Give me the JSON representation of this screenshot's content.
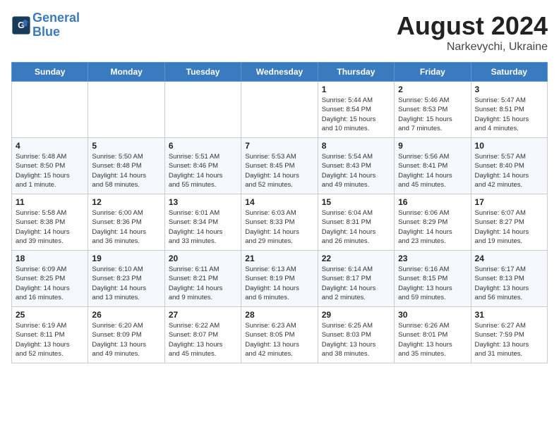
{
  "header": {
    "logo_line1": "General",
    "logo_line2": "Blue",
    "main_title": "August 2024",
    "sub_title": "Narkevychi, Ukraine"
  },
  "days_of_week": [
    "Sunday",
    "Monday",
    "Tuesday",
    "Wednesday",
    "Thursday",
    "Friday",
    "Saturday"
  ],
  "weeks": [
    [
      {
        "day": "",
        "info": ""
      },
      {
        "day": "",
        "info": ""
      },
      {
        "day": "",
        "info": ""
      },
      {
        "day": "",
        "info": ""
      },
      {
        "day": "1",
        "info": "Sunrise: 5:44 AM\nSunset: 8:54 PM\nDaylight: 15 hours\nand 10 minutes."
      },
      {
        "day": "2",
        "info": "Sunrise: 5:46 AM\nSunset: 8:53 PM\nDaylight: 15 hours\nand 7 minutes."
      },
      {
        "day": "3",
        "info": "Sunrise: 5:47 AM\nSunset: 8:51 PM\nDaylight: 15 hours\nand 4 minutes."
      }
    ],
    [
      {
        "day": "4",
        "info": "Sunrise: 5:48 AM\nSunset: 8:50 PM\nDaylight: 15 hours\nand 1 minute."
      },
      {
        "day": "5",
        "info": "Sunrise: 5:50 AM\nSunset: 8:48 PM\nDaylight: 14 hours\nand 58 minutes."
      },
      {
        "day": "6",
        "info": "Sunrise: 5:51 AM\nSunset: 8:46 PM\nDaylight: 14 hours\nand 55 minutes."
      },
      {
        "day": "7",
        "info": "Sunrise: 5:53 AM\nSunset: 8:45 PM\nDaylight: 14 hours\nand 52 minutes."
      },
      {
        "day": "8",
        "info": "Sunrise: 5:54 AM\nSunset: 8:43 PM\nDaylight: 14 hours\nand 49 minutes."
      },
      {
        "day": "9",
        "info": "Sunrise: 5:56 AM\nSunset: 8:41 PM\nDaylight: 14 hours\nand 45 minutes."
      },
      {
        "day": "10",
        "info": "Sunrise: 5:57 AM\nSunset: 8:40 PM\nDaylight: 14 hours\nand 42 minutes."
      }
    ],
    [
      {
        "day": "11",
        "info": "Sunrise: 5:58 AM\nSunset: 8:38 PM\nDaylight: 14 hours\nand 39 minutes."
      },
      {
        "day": "12",
        "info": "Sunrise: 6:00 AM\nSunset: 8:36 PM\nDaylight: 14 hours\nand 36 minutes."
      },
      {
        "day": "13",
        "info": "Sunrise: 6:01 AM\nSunset: 8:34 PM\nDaylight: 14 hours\nand 33 minutes."
      },
      {
        "day": "14",
        "info": "Sunrise: 6:03 AM\nSunset: 8:33 PM\nDaylight: 14 hours\nand 29 minutes."
      },
      {
        "day": "15",
        "info": "Sunrise: 6:04 AM\nSunset: 8:31 PM\nDaylight: 14 hours\nand 26 minutes."
      },
      {
        "day": "16",
        "info": "Sunrise: 6:06 AM\nSunset: 8:29 PM\nDaylight: 14 hours\nand 23 minutes."
      },
      {
        "day": "17",
        "info": "Sunrise: 6:07 AM\nSunset: 8:27 PM\nDaylight: 14 hours\nand 19 minutes."
      }
    ],
    [
      {
        "day": "18",
        "info": "Sunrise: 6:09 AM\nSunset: 8:25 PM\nDaylight: 14 hours\nand 16 minutes."
      },
      {
        "day": "19",
        "info": "Sunrise: 6:10 AM\nSunset: 8:23 PM\nDaylight: 14 hours\nand 13 minutes."
      },
      {
        "day": "20",
        "info": "Sunrise: 6:11 AM\nSunset: 8:21 PM\nDaylight: 14 hours\nand 9 minutes."
      },
      {
        "day": "21",
        "info": "Sunrise: 6:13 AM\nSunset: 8:19 PM\nDaylight: 14 hours\nand 6 minutes."
      },
      {
        "day": "22",
        "info": "Sunrise: 6:14 AM\nSunset: 8:17 PM\nDaylight: 14 hours\nand 2 minutes."
      },
      {
        "day": "23",
        "info": "Sunrise: 6:16 AM\nSunset: 8:15 PM\nDaylight: 13 hours\nand 59 minutes."
      },
      {
        "day": "24",
        "info": "Sunrise: 6:17 AM\nSunset: 8:13 PM\nDaylight: 13 hours\nand 56 minutes."
      }
    ],
    [
      {
        "day": "25",
        "info": "Sunrise: 6:19 AM\nSunset: 8:11 PM\nDaylight: 13 hours\nand 52 minutes."
      },
      {
        "day": "26",
        "info": "Sunrise: 6:20 AM\nSunset: 8:09 PM\nDaylight: 13 hours\nand 49 minutes."
      },
      {
        "day": "27",
        "info": "Sunrise: 6:22 AM\nSunset: 8:07 PM\nDaylight: 13 hours\nand 45 minutes."
      },
      {
        "day": "28",
        "info": "Sunrise: 6:23 AM\nSunset: 8:05 PM\nDaylight: 13 hours\nand 42 minutes."
      },
      {
        "day": "29",
        "info": "Sunrise: 6:25 AM\nSunset: 8:03 PM\nDaylight: 13 hours\nand 38 minutes."
      },
      {
        "day": "30",
        "info": "Sunrise: 6:26 AM\nSunset: 8:01 PM\nDaylight: 13 hours\nand 35 minutes."
      },
      {
        "day": "31",
        "info": "Sunrise: 6:27 AM\nSunset: 7:59 PM\nDaylight: 13 hours\nand 31 minutes."
      }
    ]
  ]
}
